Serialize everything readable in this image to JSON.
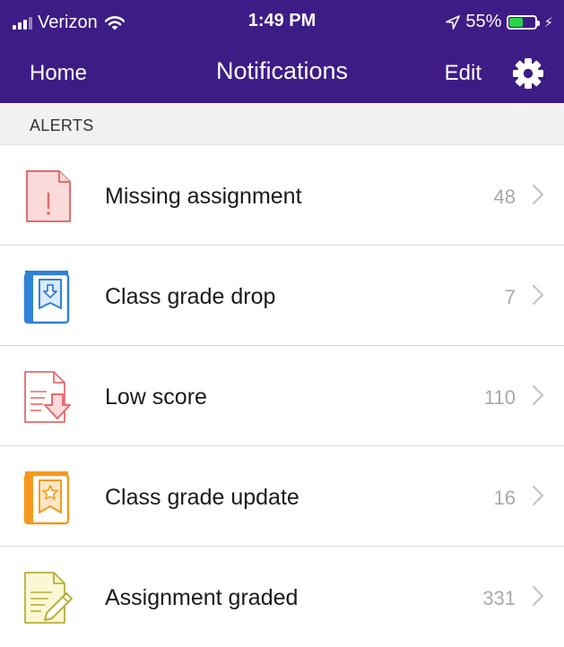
{
  "status_bar": {
    "carrier": "Verizon",
    "time": "1:49 PM",
    "battery_percent": "55%",
    "battery_level": 0.55
  },
  "nav": {
    "back_label": "Home",
    "title": "Notifications",
    "edit_label": "Edit"
  },
  "section": {
    "title": "ALERTS"
  },
  "rows": [
    {
      "label": "Missing assignment",
      "count": "48",
      "icon": "missing-assignment-icon"
    },
    {
      "label": "Class grade drop",
      "count": "7",
      "icon": "class-grade-drop-icon"
    },
    {
      "label": "Low score",
      "count": "110",
      "icon": "low-score-icon"
    },
    {
      "label": "Class grade update",
      "count": "16",
      "icon": "class-grade-update-icon"
    },
    {
      "label": "Assignment graded",
      "count": "331",
      "icon": "assignment-graded-icon"
    }
  ],
  "colors": {
    "nav_background": "#3e1c86",
    "section_background": "#f1f1f3",
    "count_text": "#a9a9a9",
    "missing_red": "#e46b6b",
    "drop_blue": "#2e82d8",
    "update_orange": "#f39a1e",
    "graded_olive": "#b8ae3e"
  }
}
